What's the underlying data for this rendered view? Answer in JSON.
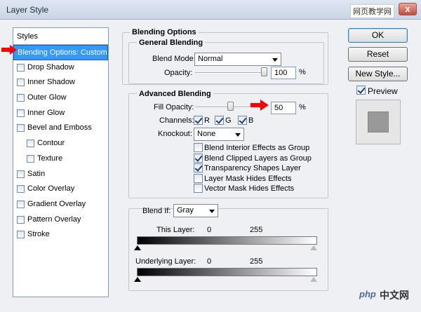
{
  "window": {
    "title": "Layer Style",
    "watermark": "网页教学网",
    "close_glyph": "x"
  },
  "styles_panel": {
    "header": "Styles",
    "items": [
      {
        "label": "Blending Options: Custom",
        "checkbox": false,
        "selected": true
      },
      {
        "label": "Drop Shadow",
        "checkbox": true,
        "checked": false
      },
      {
        "label": "Inner Shadow",
        "checkbox": true,
        "checked": false
      },
      {
        "label": "Outer Glow",
        "checkbox": true,
        "checked": false
      },
      {
        "label": "Inner Glow",
        "checkbox": true,
        "checked": false
      },
      {
        "label": "Bevel and Emboss",
        "checkbox": true,
        "checked": false
      },
      {
        "label": "Contour",
        "checkbox": true,
        "checked": false,
        "indent": true
      },
      {
        "label": "Texture",
        "checkbox": true,
        "checked": false,
        "indent": true
      },
      {
        "label": "Satin",
        "checkbox": true,
        "checked": false
      },
      {
        "label": "Color Overlay",
        "checkbox": true,
        "checked": false
      },
      {
        "label": "Gradient Overlay",
        "checkbox": true,
        "checked": false
      },
      {
        "label": "Pattern Overlay",
        "checkbox": true,
        "checked": false
      },
      {
        "label": "Stroke",
        "checkbox": true,
        "checked": false
      }
    ]
  },
  "blending_options": {
    "title": "Blending Options",
    "general": {
      "title": "General Blending",
      "blend_mode_label": "Blend Mode:",
      "blend_mode_value": "Normal",
      "opacity_label": "Opacity:",
      "opacity_value": "100",
      "opacity_unit": "%"
    },
    "advanced": {
      "title": "Advanced Blending",
      "fill_opacity_label": "Fill Opacity:",
      "fill_opacity_value": "50",
      "fill_opacity_unit": "%",
      "channels_label": "Channels:",
      "channel_r": "R",
      "channel_g": "G",
      "channel_b": "B",
      "knockout_label": "Knockout:",
      "knockout_value": "None",
      "options": [
        {
          "label": "Blend Interior Effects as Group",
          "checked": false
        },
        {
          "label": "Blend Clipped Layers as Group",
          "checked": true
        },
        {
          "label": "Transparency Shapes Layer",
          "checked": true
        },
        {
          "label": "Layer Mask Hides Effects",
          "checked": false
        },
        {
          "label": "Vector Mask Hides Effects",
          "checked": false
        }
      ]
    },
    "blend_if": {
      "label": "Blend If:",
      "value": "Gray",
      "this_layer_label": "This Layer:",
      "this_layer_min": "0",
      "this_layer_max": "255",
      "underlying_label": "Underlying Layer:",
      "underlying_min": "0",
      "underlying_max": "255"
    }
  },
  "buttons": {
    "ok": "OK",
    "reset": "Reset",
    "new_style": "New Style...",
    "preview_label": "Preview"
  },
  "colors": {
    "selection": "#3399ff",
    "arrow": "#ff0000",
    "preview_swatch": "#999999"
  },
  "footer": {
    "logo_php": "php",
    "logo_cn": "中文网"
  }
}
